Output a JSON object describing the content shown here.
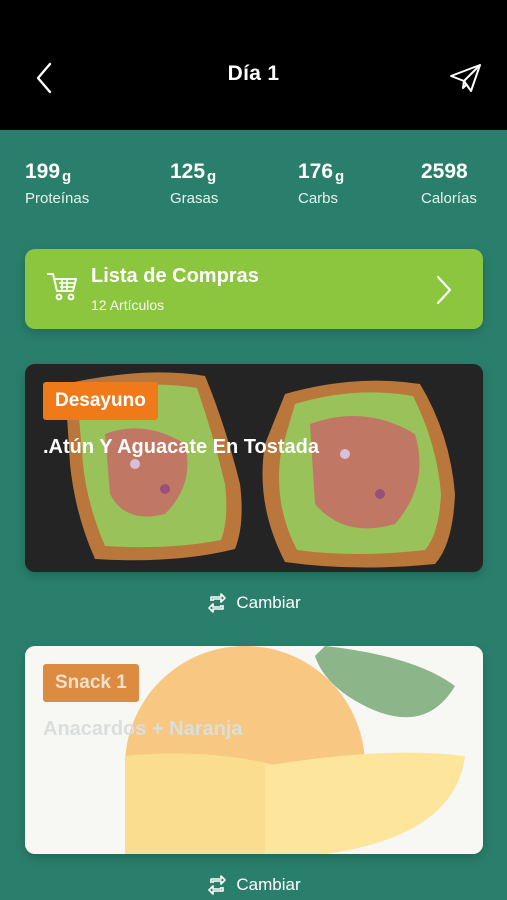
{
  "header": {
    "title": "Día 1",
    "back_icon": "chevron-left-icon",
    "send_icon": "paper-plane-icon"
  },
  "macros": [
    {
      "value": "199",
      "unit": "g",
      "label": "Proteínas"
    },
    {
      "value": "125",
      "unit": "g",
      "label": "Grasas"
    },
    {
      "value": "176",
      "unit": "g",
      "label": "Carbs"
    },
    {
      "value": "2598",
      "unit": "",
      "label": "Calorías"
    }
  ],
  "shopping": {
    "title": "Lista de Compras",
    "subtitle": "12 Artículos",
    "icon": "shopping-cart-icon"
  },
  "meals": [
    {
      "badge": "Desayuno",
      "name": ".Atún Y Aguacate En Tostada",
      "change_label": "Cambiar"
    },
    {
      "badge": "Snack 1",
      "name": "Anacardos + Naranja",
      "change_label": "Cambiar"
    }
  ],
  "colors": {
    "background": "#2a7f6c",
    "header": "#000000",
    "shopping_card": "#8cc63f",
    "badge_orange": "#f07a1a"
  }
}
